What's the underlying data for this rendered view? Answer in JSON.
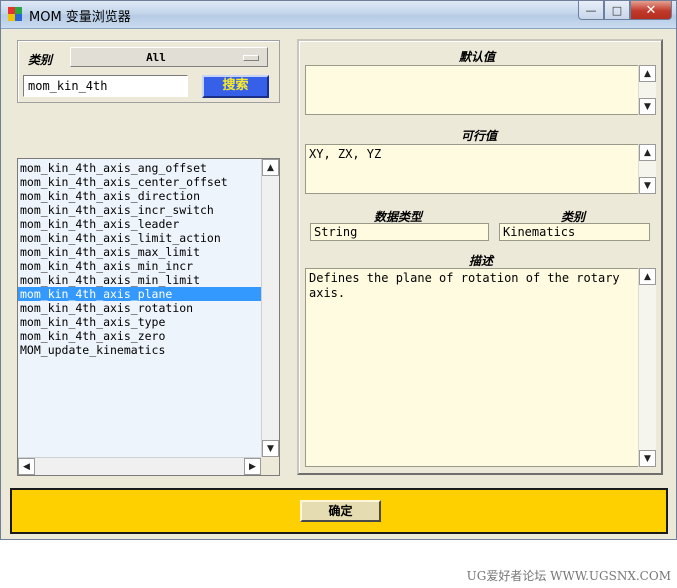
{
  "window": {
    "title": "MOM 变量浏览器",
    "minimize": "—",
    "maximize": "□",
    "close": "✕"
  },
  "left": {
    "category_label": "类别",
    "category_value": "All",
    "search_value": "mom_kin_4th",
    "search_button": "搜索",
    "items": [
      "mom_kin_4th_axis_ang_offset",
      "mom_kin_4th_axis_center_offset",
      "mom_kin_4th_axis_direction",
      "mom_kin_4th_axis_incr_switch",
      "mom_kin_4th_axis_leader",
      "mom_kin_4th_axis_limit_action",
      "mom_kin_4th_axis_max_limit",
      "mom_kin_4th_axis_min_incr",
      "mom_kin_4th_axis_min_limit",
      "mom_kin_4th_axis_plane",
      "mom_kin_4th_axis_rotation",
      "mom_kin_4th_axis_type",
      "mom_kin_4th_axis_zero",
      "MOM_update_kinematics"
    ],
    "selected_index": 9
  },
  "right": {
    "default_label": "默认值",
    "default_value": "",
    "feasible_label": "可行值",
    "feasible_value": "XY, ZX, YZ",
    "datatype_label": "数据类型",
    "datatype_value": "String",
    "category_label": "类别",
    "category_value": "Kinematics",
    "description_label": "描述",
    "description_value": "Defines the plane of rotation of the rotary axis."
  },
  "footer": {
    "ok_button": "确定"
  },
  "watermark": "UG爱好者论坛 WWW.UGSNX.COM",
  "colors": {
    "bottom_bar": "#ffd000",
    "search_button_bg": "#3660e8",
    "search_button_text": "#f8ea2a",
    "selection": "#3399ff",
    "field_bg": "#fffbe0"
  },
  "icons": {
    "app": "app-icon",
    "scroll_up": "arrow-up-icon",
    "scroll_down": "arrow-down-icon",
    "scroll_left": "arrow-left-icon",
    "scroll_right": "arrow-right-icon"
  }
}
